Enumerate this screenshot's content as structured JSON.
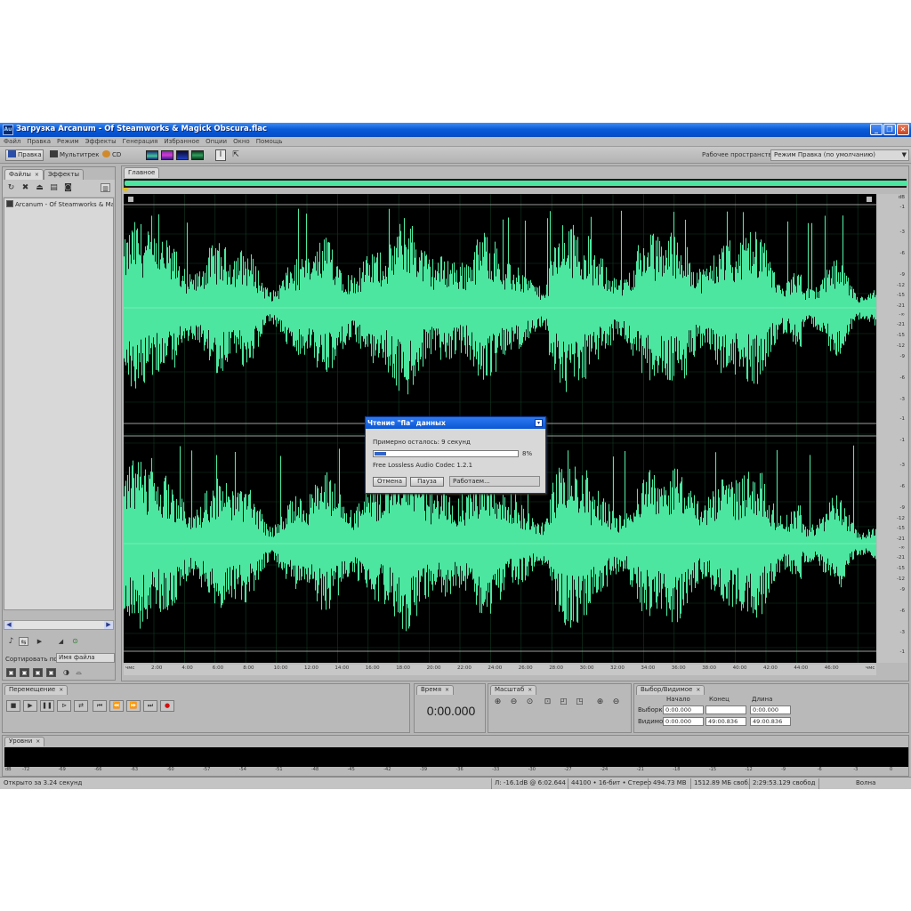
{
  "window": {
    "title": "Загрузка Arcanum - Of Steamworks & Magick Obscura.flac",
    "app_icon": "Au"
  },
  "menu": [
    "Файл",
    "Правка",
    "Режим",
    "Эффекты",
    "Генерация",
    "Избранное",
    "Опции",
    "Окно",
    "Помощь"
  ],
  "toolbar": {
    "edit_label": "Правка",
    "multitrack_label": "Мультитрек",
    "cd_label": "CD",
    "workspace_label": "Рабочее пространство:",
    "workspace_value": "Режим Правка (по умолчанию)"
  },
  "files_panel": {
    "tab_files": "Файлы",
    "tab_effects": "Эффекты",
    "close": "×",
    "file_name": "Arcanum - Of Steamworks & Magic",
    "sort_label": "Сортировать по:",
    "sort_value": "Имя файла"
  },
  "editor": {
    "tab": "Главное",
    "db_label": "dB",
    "db_top": [
      "-1",
      "-3",
      "-6",
      "-9",
      "-12",
      "-15",
      "-21",
      "-∞",
      "-21",
      "-15",
      "-12",
      "-9",
      "-6",
      "-3",
      "-1"
    ],
    "db_bottom": [
      "-1",
      "-3",
      "-6",
      "-9",
      "-12",
      "-15",
      "-21",
      "-∞",
      "-21",
      "-15",
      "-12",
      "-9",
      "-6",
      "-3",
      "-1"
    ],
    "time_start": "чмс",
    "time_end": "чмс",
    "time_ticks": [
      "2:00",
      "4:00",
      "6:00",
      "8:00",
      "10:00",
      "12:00",
      "14:00",
      "16:00",
      "18:00",
      "20:00",
      "22:00",
      "24:00",
      "26:00",
      "28:00",
      "30:00",
      "32:00",
      "34:00",
      "36:00",
      "38:00",
      "40:00",
      "42:00",
      "44:00",
      "46:00"
    ],
    "wave_color": "#4ce6a0"
  },
  "dialog": {
    "title": "Чтение \"fla\" данных",
    "remaining": "Примерно осталось: 9 секунд",
    "progress": 0.08,
    "percent": "8%",
    "codec": "Free Lossless Audio Codec 1.2.1",
    "cancel": "Отмена",
    "pause": "Пауза",
    "status": "Работаем..."
  },
  "transport": {
    "tab": "Перемещение",
    "buttons": [
      "stop-icon",
      "play-icon",
      "pause-icon",
      "play-from-cursor-icon",
      "loop-icon",
      "go-start-icon",
      "rewind-icon",
      "fast-forward-icon",
      "go-end-icon",
      "record-icon"
    ]
  },
  "time": {
    "tab": "Время",
    "value": "0:00.000"
  },
  "zoom": {
    "tab": "Масштаб"
  },
  "selection": {
    "tab": "Выбор/Видимое",
    "col_start": "Начало",
    "col_end": "Конец",
    "col_length": "Длина",
    "row_selection": "Выборка",
    "row_view": "Видимое",
    "sel_start": "0:00.000",
    "sel_end": "",
    "sel_length": "0:00.000",
    "view_start": "0:00.000",
    "view_end": "49:00.836",
    "view_length": "49:00.836"
  },
  "levels": {
    "tab": "Уровни",
    "db_label": "dB",
    "ticks": [
      "-72",
      "-69",
      "-66",
      "-63",
      "-60",
      "-57",
      "-54",
      "-51",
      "-48",
      "-45",
      "-42",
      "-39",
      "-36",
      "-33",
      "-30",
      "-27",
      "-24",
      "-21",
      "-18",
      "-15",
      "-12",
      "-9",
      "-6",
      "-3",
      "0"
    ]
  },
  "status": {
    "opened": "Открыто за 3.24 секунд",
    "level": "Л: -16.1dB @   6:02.644",
    "format": "44100 • 16-бит • Стерео",
    "size": "494.73 MB",
    "free": "1512.89 МБ своб.",
    "free_time": "2:29:53.129 свобод",
    "mode": "Волна"
  }
}
